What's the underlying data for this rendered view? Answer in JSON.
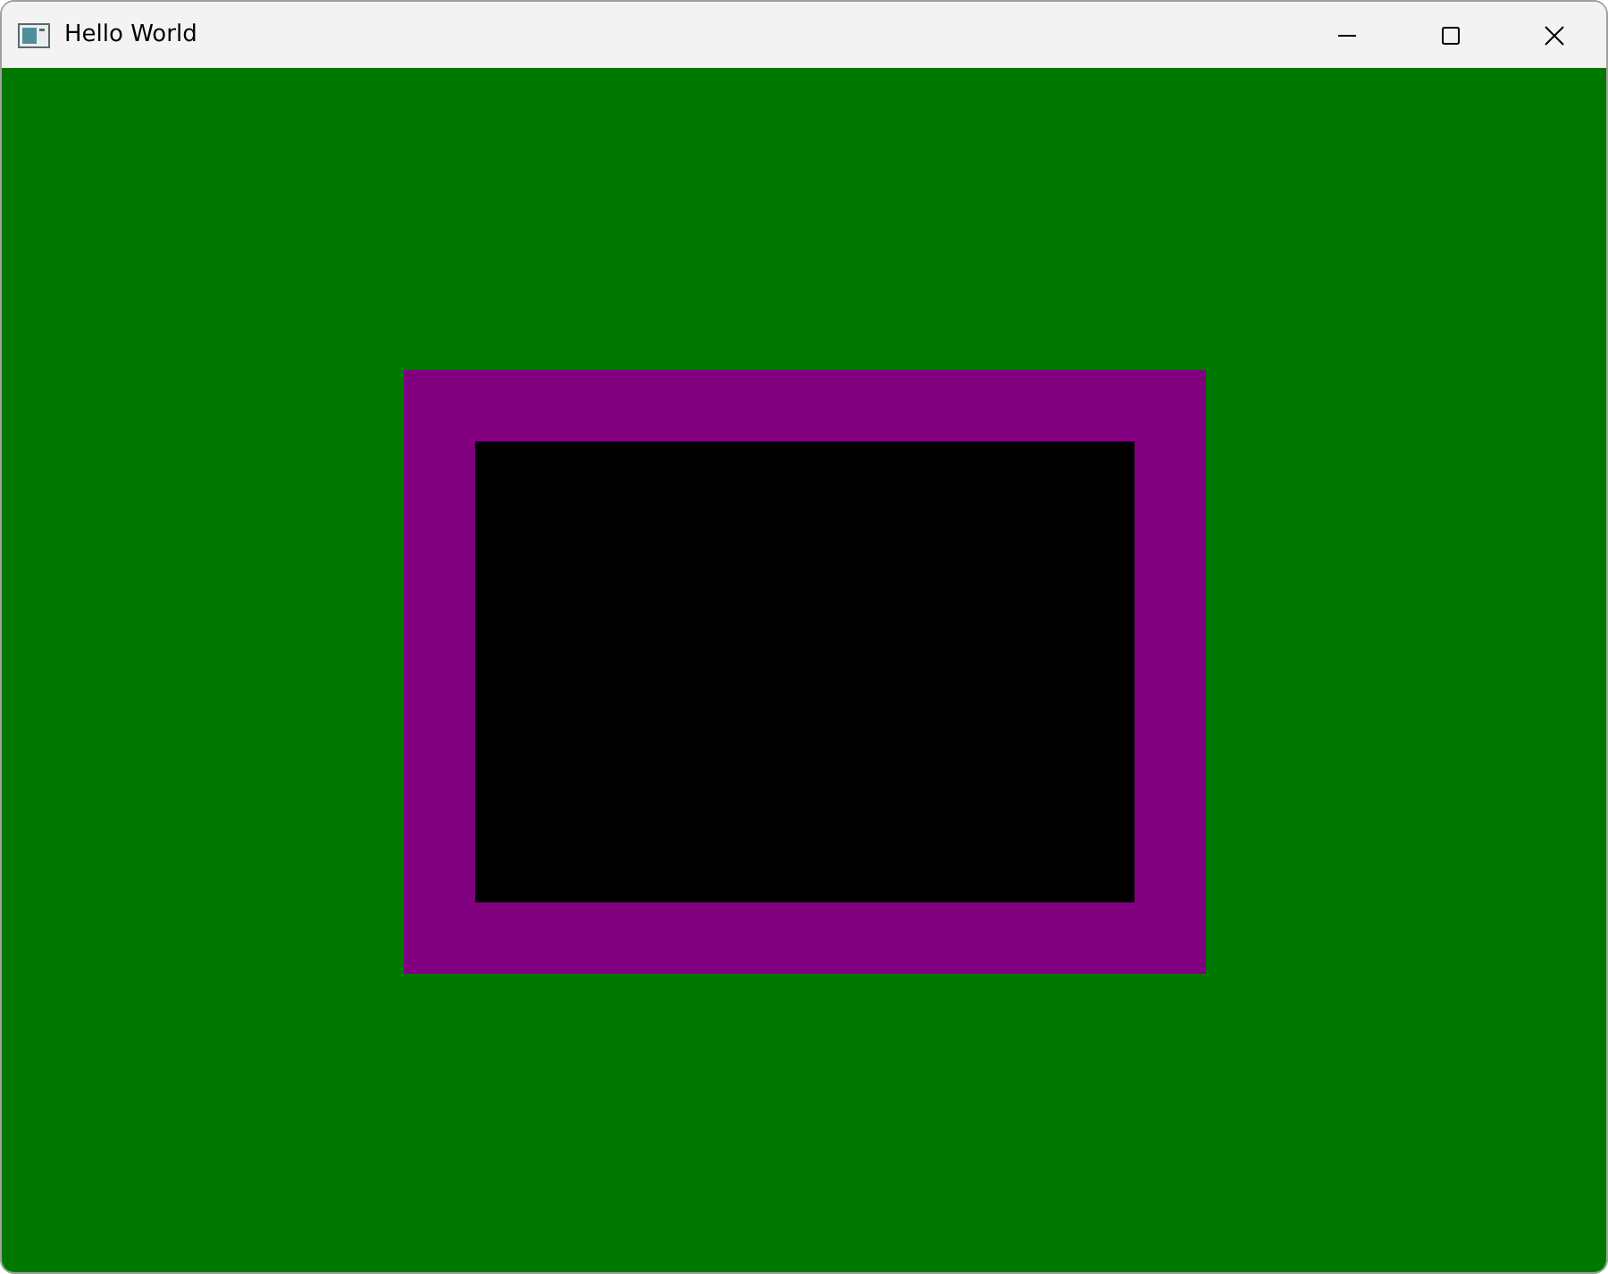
{
  "window": {
    "title": "Hello World"
  }
}
